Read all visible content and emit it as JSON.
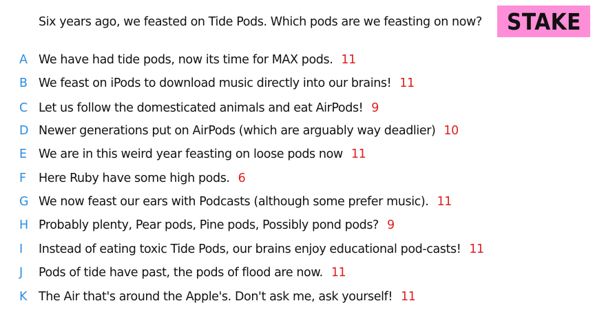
{
  "question": "Six years ago, we feasted on Tide Pods. Which pods are we feasting on now?",
  "badge": "STAKE",
  "colors": {
    "letter": "#2a8ee0",
    "score": "#e01e1e",
    "badge_bg": "#ff8ed8"
  },
  "answers": [
    {
      "letter": "A",
      "text": "We have had tide pods, now its time for MAX pods.",
      "score": "11"
    },
    {
      "letter": "B",
      "text": "We feast on iPods to download music directly into our brains!",
      "score": "11"
    },
    {
      "letter": "C",
      "text": "Let us follow the domesticated animals and eat AirPods!",
      "score": "9"
    },
    {
      "letter": "D",
      "text": "Newer generations put on AirPods (which are arguably way deadlier)",
      "score": "10"
    },
    {
      "letter": "E",
      "text": "We are in this weird year feasting on loose pods now",
      "score": "11"
    },
    {
      "letter": "F",
      "text": "Here Ruby have some high pods.",
      "score": "6"
    },
    {
      "letter": "G",
      "text": "We now feast our ears with Podcasts (although some prefer music).",
      "score": "11"
    },
    {
      "letter": "H",
      "text": "Probably plenty, Pear pods, Pine pods, Possibly pond pods?",
      "score": "9"
    },
    {
      "letter": "I",
      "text": "Instead of eating toxic Tide Pods, our brains enjoy educational pod-casts!",
      "score": "11"
    },
    {
      "letter": "J",
      "text": "Pods of tide have past, the pods of flood are now.",
      "score": "11"
    },
    {
      "letter": "K",
      "text": "The Air that's around the Apple's. Don't ask me, ask yourself!",
      "score": "11"
    }
  ]
}
